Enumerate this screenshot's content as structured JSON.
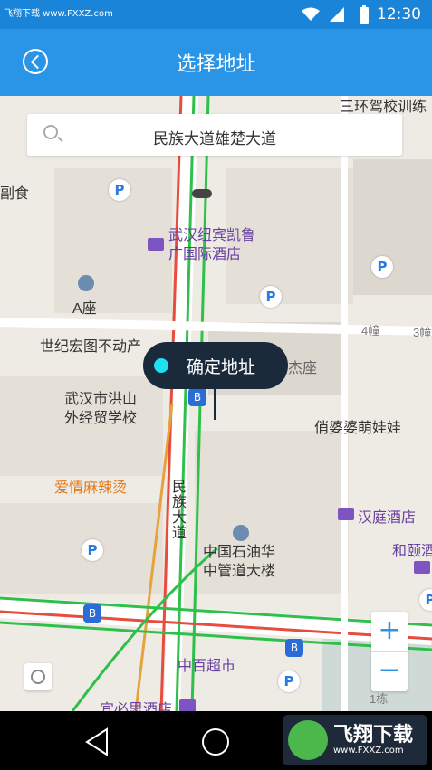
{
  "status_bar": {
    "watermark": "飞翔下载 www.FXXZ.com",
    "time": "12:30"
  },
  "header": {
    "title": "选择地址"
  },
  "search": {
    "value": "民族大道雄楚大道"
  },
  "map_labels": {
    "top_right": "三环驾校训练",
    "left_food": "副食",
    "hotel_name": "武汉纽宾凯鲁广国际酒店",
    "a_building": "A座",
    "realty": "世纪宏图不动产",
    "school": "武汉市洪山外经贸学校",
    "tower": "杰座",
    "bld4": "4幢",
    "bld3": "3幢",
    "kids_shop": "俏婆婆萌娃娃",
    "spicy": "爱情麻辣烫",
    "road": "民族大道",
    "hanting": "汉庭酒店",
    "hehe": "和颐酒",
    "petro": "中国石油华中管道大楼",
    "supermarket": "中百超市",
    "yibisi": "宜必思酒店",
    "bld1": "1栋"
  },
  "confirm_bubble": {
    "label": "确定地址"
  },
  "zoom": {
    "in": "+",
    "out": "−"
  },
  "brand": {
    "logo_text": "飞翔下载",
    "logo_url": "www.FXXZ.com"
  },
  "icons": {
    "back": "back-icon",
    "search": "search-icon",
    "locate": "locate-icon",
    "parking": "P",
    "bus": "B"
  },
  "colors": {
    "header": "#2a94e6",
    "status": "#1a84d8",
    "bubble": "#1b2a3a",
    "dot": "#1ee0f0"
  }
}
